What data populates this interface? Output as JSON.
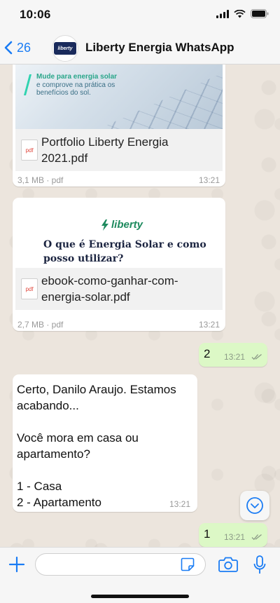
{
  "status_bar": {
    "time": "10:06"
  },
  "header": {
    "back_count": "26",
    "avatar_text": "liberty",
    "title": "Liberty Energia WhatsApp"
  },
  "messages": {
    "doc1": {
      "banner_line1": "Mude para energia solar",
      "banner_line2": "e comprove na prática os",
      "banner_line3": "benefícios do sol.",
      "file_icon": "pdf",
      "file_name": "Portfolio Liberty Energia 2021.pdf",
      "meta": "3,1 MB · pdf",
      "time": "13:21"
    },
    "doc2": {
      "logo_text": "liberty",
      "cover_title_line1": "O que é Energia Solar e como",
      "cover_title_line2": "posso utilizar?",
      "file_icon": "pdf",
      "file_name": "ebook-como-ganhar-com-energia-solar.pdf",
      "meta": "2,7 MB · pdf",
      "time": "13:21"
    },
    "out1": {
      "text": "2",
      "time": "13:21"
    },
    "incoming_text": {
      "lines": [
        "Certo, Danilo Araujo. Estamos",
        "acabando...",
        "",
        "Você mora em casa ou",
        "apartamento?",
        "",
        "1 - Casa",
        "2 - Apartamento"
      ],
      "time": "13:21"
    },
    "out2": {
      "text": "1",
      "time": "13:21"
    }
  },
  "input": {
    "placeholder": ""
  },
  "colors": {
    "accent": "#1a7cf4",
    "outgoing_bubble": "#dcf8c6",
    "incoming_bubble": "#ffffff",
    "chat_background": "#ece5dd",
    "read_ticks": "#8b9a86"
  },
  "icons": {
    "back": "chevron-left-icon",
    "add": "plus-icon",
    "sticker": "sticker-icon",
    "camera": "camera-icon",
    "mic": "microphone-icon",
    "scroll": "chevron-down-icon",
    "signal": "signal-icon",
    "wifi": "wifi-icon",
    "battery": "battery-icon"
  }
}
